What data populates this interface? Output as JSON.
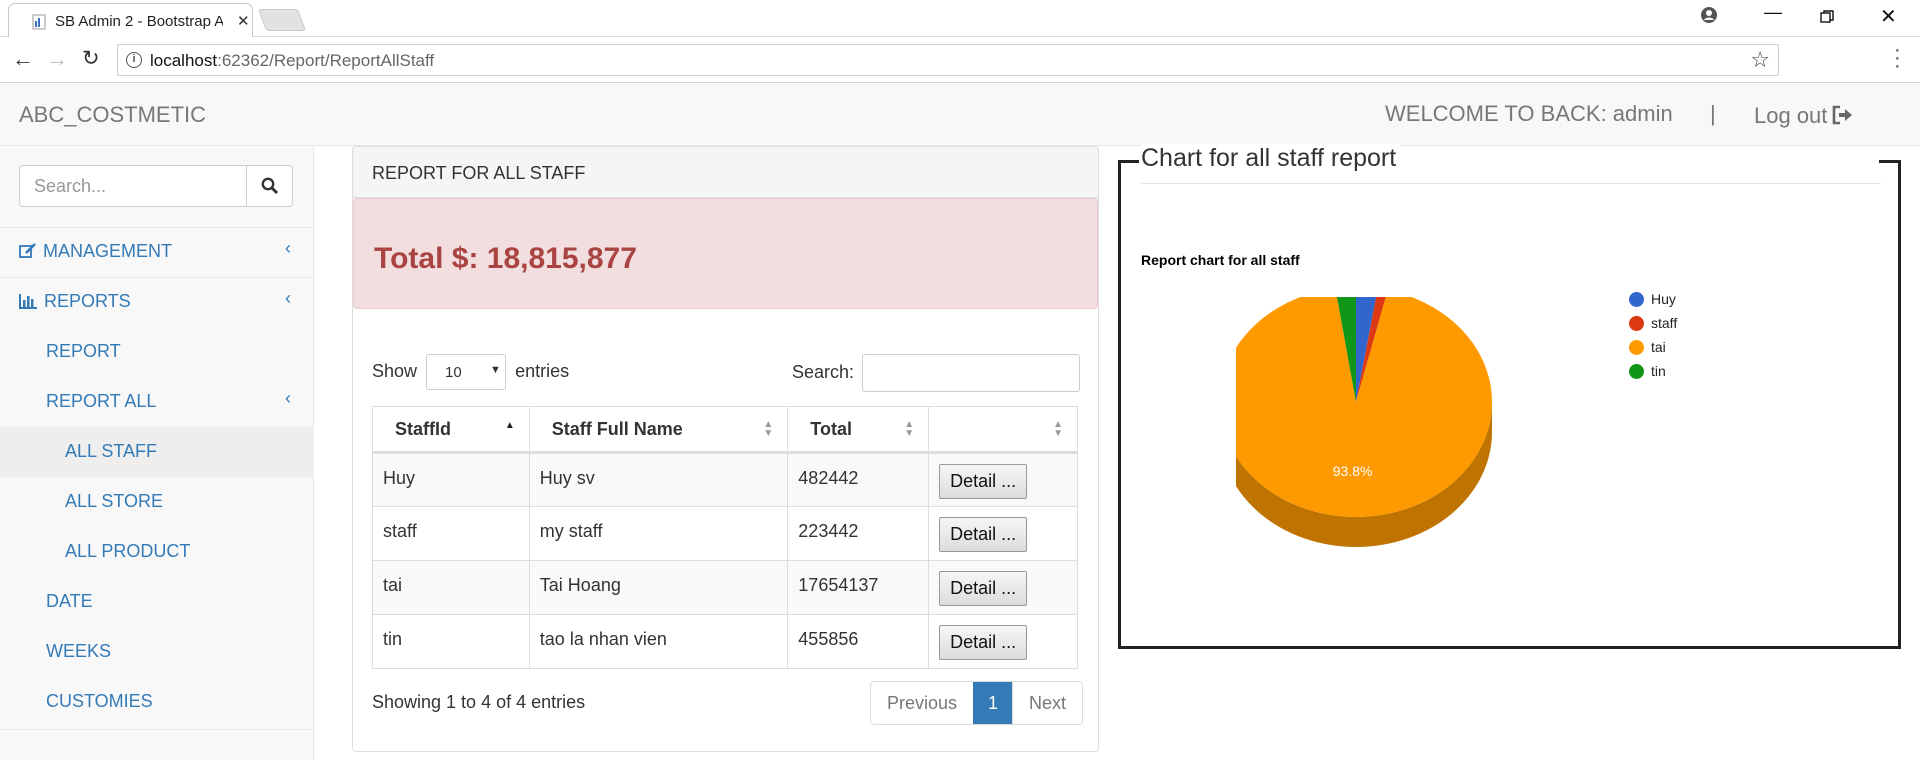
{
  "browser": {
    "tab_title": "SB Admin 2 - Bootstrap A",
    "url_host": "localhost",
    "url_path": ":62362/Report/ReportAllStaff"
  },
  "navbar": {
    "brand": "ABC_COSTMETIC",
    "welcome": "WELCOME TO BACK: admin",
    "separator": "|",
    "logout": "Log out"
  },
  "sidebar": {
    "search_placeholder": "Search...",
    "items": {
      "management": "MANAGEMENT",
      "reports": "REPORTS",
      "report": "REPORT",
      "report_all": "REPORT ALL",
      "all_staff": "ALL STAFF",
      "all_store": "ALL STORE",
      "all_product": "ALL PRODUCT",
      "date": "DATE",
      "weeks": "WEEKS",
      "customies": "CUSTOMIES"
    }
  },
  "panel": {
    "heading": "REPORT FOR ALL STAFF",
    "total": "Total $: 18,815,877"
  },
  "table": {
    "show_label": "Show",
    "length_value": "10",
    "entries_label": "entries",
    "search_label": "Search:",
    "columns": [
      "StaffId",
      "Staff Full Name",
      "Total",
      ""
    ],
    "rows": [
      {
        "id": "Huy",
        "name": "Huy sv",
        "total": "482442",
        "action": "Detail ..."
      },
      {
        "id": "staff",
        "name": "my staff",
        "total": "223442",
        "action": "Detail ..."
      },
      {
        "id": "tai",
        "name": "Tai Hoang",
        "total": "17654137",
        "action": "Detail ..."
      },
      {
        "id": "tin",
        "name": "tao la nhan vien",
        "total": "455856",
        "action": "Detail ..."
      }
    ],
    "info": "Showing 1 to 4 of 4 entries",
    "pager": {
      "prev": "Previous",
      "page": "1",
      "next": "Next"
    }
  },
  "chart_section": {
    "legend_title": "Chart for all staff report"
  },
  "chart_data": {
    "type": "pie",
    "title": "Report chart for all staff",
    "categories": [
      "Huy",
      "staff",
      "tai",
      "tin"
    ],
    "values": [
      482442,
      223442,
      17654137,
      455856
    ],
    "colors": [
      "#3366cc",
      "#dc3912",
      "#ff9900",
      "#109618"
    ],
    "slice_labels": [
      "",
      "",
      "93.8%",
      ""
    ],
    "is3D": true,
    "legend_position": "right"
  }
}
